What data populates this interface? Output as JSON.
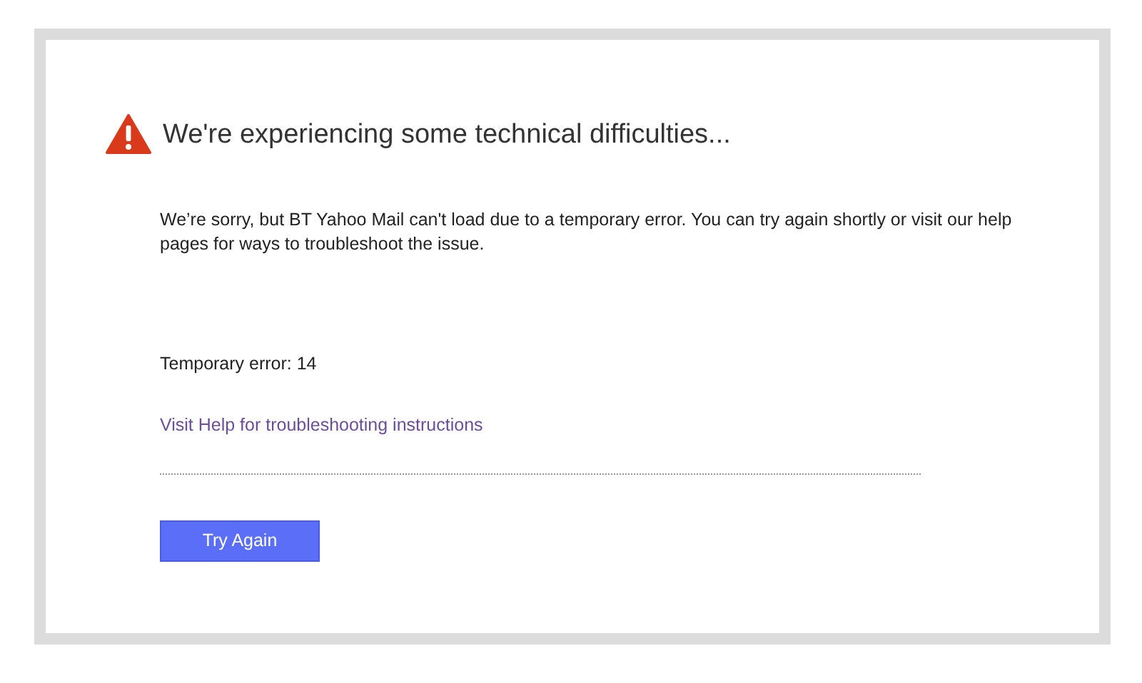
{
  "heading": "We're experiencing some technical difficulties...",
  "message": "We’re sorry, but BT Yahoo Mail can't load due to a temporary error. You can try again shortly or visit our help pages for ways to troubleshoot the issue.",
  "error_code": "Temporary error: 14",
  "help_link": "Visit Help for troubleshooting instructions",
  "button": "Try Again"
}
